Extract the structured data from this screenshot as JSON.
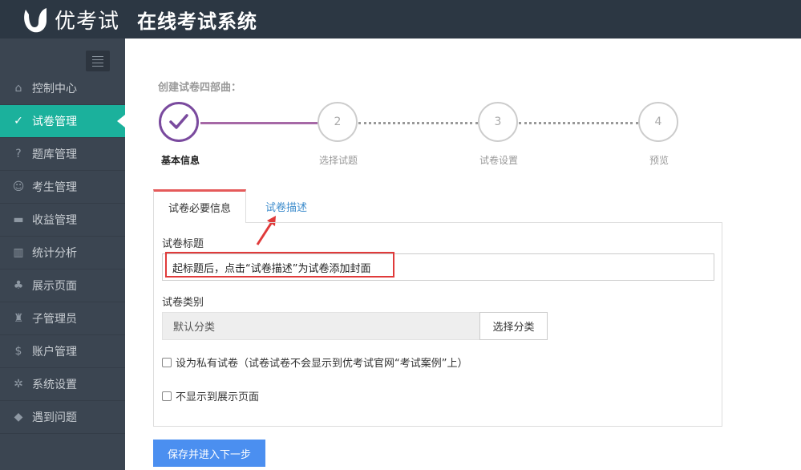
{
  "header": {
    "brand": "优考试",
    "title": "在线考试系统"
  },
  "sidebar": {
    "items": [
      {
        "label": "控制中心",
        "icon": "home-icon"
      },
      {
        "label": "试卷管理",
        "icon": "check-circle-icon",
        "active": true
      },
      {
        "label": "题库管理",
        "icon": "question-circle-icon"
      },
      {
        "label": "考生管理",
        "icon": "user-icon"
      },
      {
        "label": "收益管理",
        "icon": "credit-card-icon"
      },
      {
        "label": "统计分析",
        "icon": "bar-chart-icon"
      },
      {
        "label": "展示页面",
        "icon": "display-icon"
      },
      {
        "label": "子管理员",
        "icon": "sub-admin-icon"
      },
      {
        "label": "账户管理",
        "icon": "dollar-icon"
      },
      {
        "label": "系统设置",
        "icon": "gear-icon"
      },
      {
        "label": "遇到问题",
        "icon": "tag-icon"
      }
    ]
  },
  "steps": {
    "title": "创建试卷四部曲：",
    "items": [
      {
        "number": "",
        "label": "基本信息",
        "done": true
      },
      {
        "number": "2",
        "label": "选择试题"
      },
      {
        "number": "3",
        "label": "试卷设置"
      },
      {
        "number": "4",
        "label": "预览"
      }
    ]
  },
  "tabs": {
    "active": "试卷必要信息",
    "inactive": "试卷描述"
  },
  "form": {
    "title_label": "试卷标题",
    "title_value": "起标题后，点击“试卷描述”为试卷添加封面",
    "category_label": "试卷类别",
    "category_value": "默认分类",
    "category_button": "选择分类",
    "private_label": "设为私有试卷（试卷试卷不会显示到优考试官网“考试案例”上）",
    "hide_label": "不显示到展示页面"
  },
  "actions": {
    "save": "保存并进入下一步"
  },
  "colors": {
    "topbar": "#2c3743",
    "sidebar": "#3b4551",
    "active": "#1bb19c",
    "step_done": "#7a4a9e",
    "primary": "#4b8ff0",
    "highlight": "#e03a3a"
  }
}
